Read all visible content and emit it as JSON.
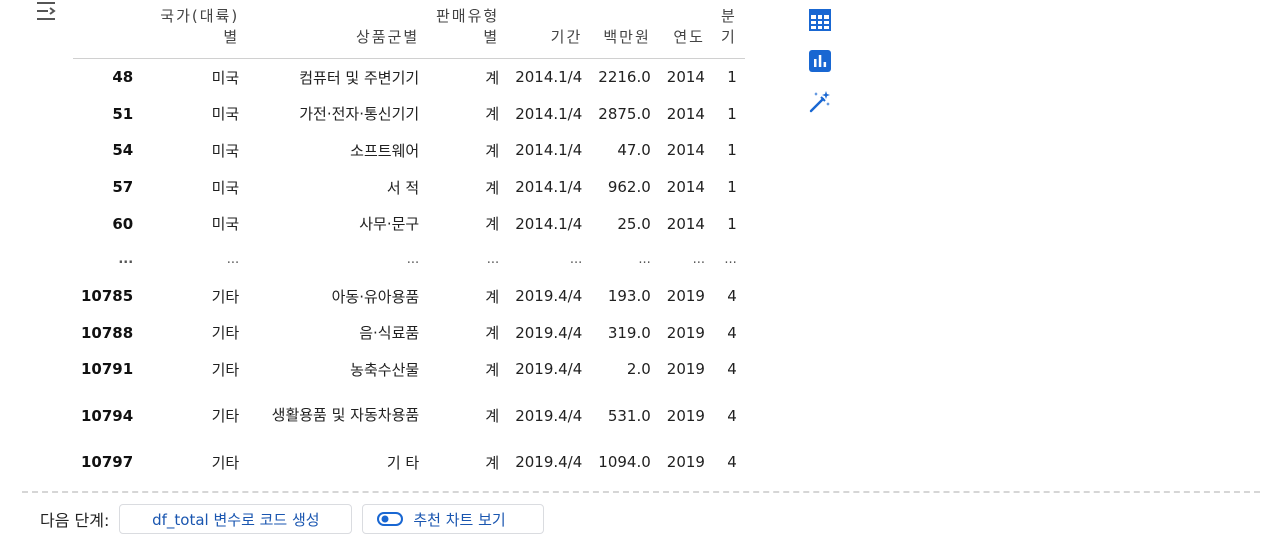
{
  "table": {
    "columns": [
      "",
      "국가(대륙)별",
      "상품군별",
      "판매유형별",
      "기간",
      "백만원",
      "연도",
      "분기"
    ],
    "rows": [
      [
        "48",
        "미국",
        "컴퓨터 및 주변기기",
        "계",
        "2014.1/4",
        "2216.0",
        "2014",
        "1"
      ],
      [
        "51",
        "미국",
        "가전·전자·통신기기",
        "계",
        "2014.1/4",
        "2875.0",
        "2014",
        "1"
      ],
      [
        "54",
        "미국",
        "소프트웨어",
        "계",
        "2014.1/4",
        "47.0",
        "2014",
        "1"
      ],
      [
        "57",
        "미국",
        "서 적",
        "계",
        "2014.1/4",
        "962.0",
        "2014",
        "1"
      ],
      [
        "60",
        "미국",
        "사무·문구",
        "계",
        "2014.1/4",
        "25.0",
        "2014",
        "1"
      ],
      [
        "...",
        "...",
        "...",
        "...",
        "...",
        "...",
        "...",
        "..."
      ],
      [
        "10785",
        "기타",
        "아동·유아용품",
        "계",
        "2019.4/4",
        "193.0",
        "2019",
        "4"
      ],
      [
        "10788",
        "기타",
        "음·식료품",
        "계",
        "2019.4/4",
        "319.0",
        "2019",
        "4"
      ],
      [
        "10791",
        "기타",
        "농축수산물",
        "계",
        "2019.4/4",
        "2.0",
        "2019",
        "4"
      ],
      [
        "10794",
        "기타",
        "생활용품 및 자동차용품",
        "계",
        "2019.4/4",
        "531.0",
        "2019",
        "4"
      ],
      [
        "10797",
        "기타",
        "기 타",
        "계",
        "2019.4/4",
        "1094.0",
        "2019",
        "4"
      ]
    ]
  },
  "next_steps": {
    "label": "다음 단계:",
    "generate_code_button": "df_total 변수로 코드 생성",
    "recommend_chart_button": "추천 차트 보기"
  },
  "icons": {
    "output_toggle": "output-toggle-icon",
    "table_view": "table-icon",
    "chart_view": "bar-chart-icon",
    "magic": "magic-wand-icon"
  },
  "colors": {
    "accent": "#1967d2",
    "button_text": "#1a56b0"
  }
}
